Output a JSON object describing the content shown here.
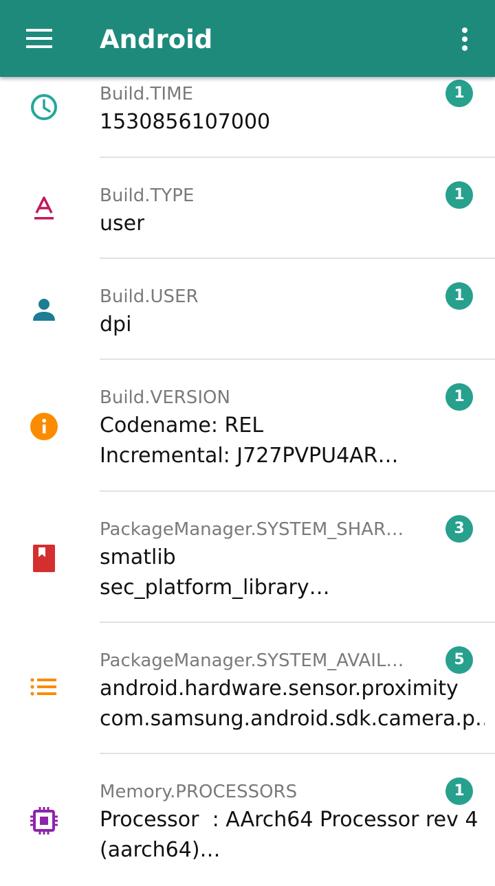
{
  "appbar": {
    "title": "Android",
    "menu_icon": "hamburger-menu-icon",
    "overflow_icon": "more-vert-icon",
    "background_color": "#1e8a7c"
  },
  "accent_color": "#27a08e",
  "items": [
    {
      "key": "Build.TIME",
      "lines": [
        "1530856107000"
      ],
      "badge": "1",
      "icon": "clock-icon",
      "icon_color": "#26a69a"
    },
    {
      "key": "Build.TYPE",
      "lines": [
        "user"
      ],
      "badge": "1",
      "icon": "text-format-icon",
      "icon_color": "#c2185b"
    },
    {
      "key": "Build.USER",
      "lines": [
        "dpi"
      ],
      "badge": "1",
      "icon": "person-icon",
      "icon_color": "#1e7c95"
    },
    {
      "key": "Build.VERSION",
      "lines": [
        "Codename: REL",
        "Incremental: J727PVPU4AR…"
      ],
      "badge": "1",
      "icon": "info-icon",
      "icon_color": "#fb8c00"
    },
    {
      "key": "PackageManager.SYSTEM_SHAR…",
      "lines": [
        "smatlib",
        "sec_platform_library…"
      ],
      "badge": "3",
      "icon": "book-icon",
      "icon_color": "#d32f2f"
    },
    {
      "key": "PackageManager.SYSTEM_AVAIL…",
      "lines": [
        "android.hardware.sensor.proximity",
        "com.samsung.android.sdk.camera.p…"
      ],
      "badge": "5",
      "icon": "list-icon",
      "icon_color": "#fb8c00"
    },
    {
      "key": "Memory.PROCESSORS",
      "lines": [
        "Processor  : AArch64 Processor rev 4",
        "(aarch64)…"
      ],
      "badge": "1",
      "icon": "chip-icon",
      "icon_color": "#8e24aa"
    }
  ]
}
